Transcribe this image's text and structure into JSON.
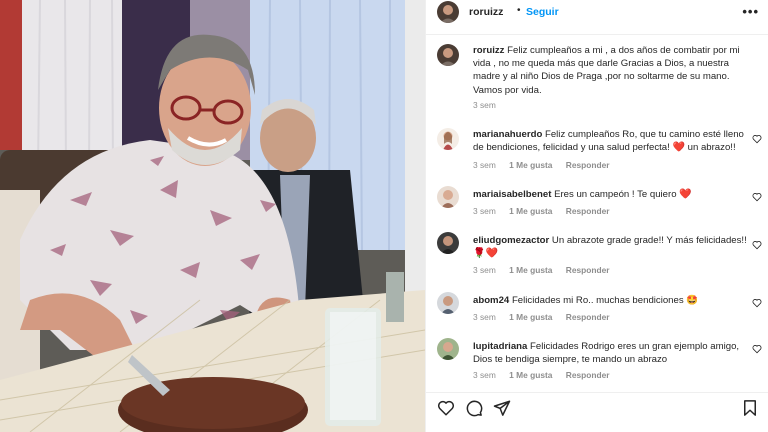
{
  "post": {
    "username": "roruizz",
    "separator": "•",
    "follow_label": "Seguir",
    "more_label": "•••"
  },
  "caption": {
    "username": "roruizz",
    "text": "Feliz cumpleaños a mi , a dos años de combatir por mi vida , no me queda más que darle Gracias a Dios, a nuestra madre y al niño Dios de Praga ,por no soltarme de su mano. Vamos por vida.",
    "time": "3 sem"
  },
  "comments": [
    {
      "username": "marianahuerdo",
      "text": "Feliz cumpleaños Ro, que tu camino esté lleno de bendiciones, felicidad y una salud perfecta!",
      "emoji": "❤️",
      "text_after": " un abrazo!!",
      "time": "3 sem",
      "likes": "1 Me gusta",
      "reply": "Responder"
    },
    {
      "username": "mariaisabelbenet",
      "text": "Eres un campeón ! Te quiero",
      "emoji": "❤️",
      "text_after": "",
      "time": "3 sem",
      "likes": "1 Me gusta",
      "reply": "Responder"
    },
    {
      "username": "eliudgomezactor",
      "text": "Un abrazote grade grade!! Y más felicidades!!",
      "emoji": "🌹❤️",
      "text_after": "",
      "time": "3 sem",
      "likes": "1 Me gusta",
      "reply": "Responder"
    },
    {
      "username": "abom24",
      "text": "Felicidades mi Ro.. muchas bendiciones",
      "emoji": "🤩",
      "text_after": "",
      "time": "3 sem",
      "likes": "1 Me gusta",
      "reply": "Responder"
    },
    {
      "username": "lupitadriana",
      "text": "Felicidades Rodrigo eres un gran ejemplo amigo, Dios te bendiga siempre, te mando un abrazo",
      "emoji": "",
      "text_after": "",
      "time": "3 sem",
      "likes": "1 Me gusta",
      "reply": "Responder"
    }
  ],
  "actions": {
    "like": "heart-icon",
    "comment": "comment-icon",
    "share": "share-icon",
    "save": "bookmark-icon"
  },
  "colors": {
    "link": "#0095f6",
    "text": "#262626",
    "muted": "#8e8e8e",
    "heart": "#e0245e"
  }
}
